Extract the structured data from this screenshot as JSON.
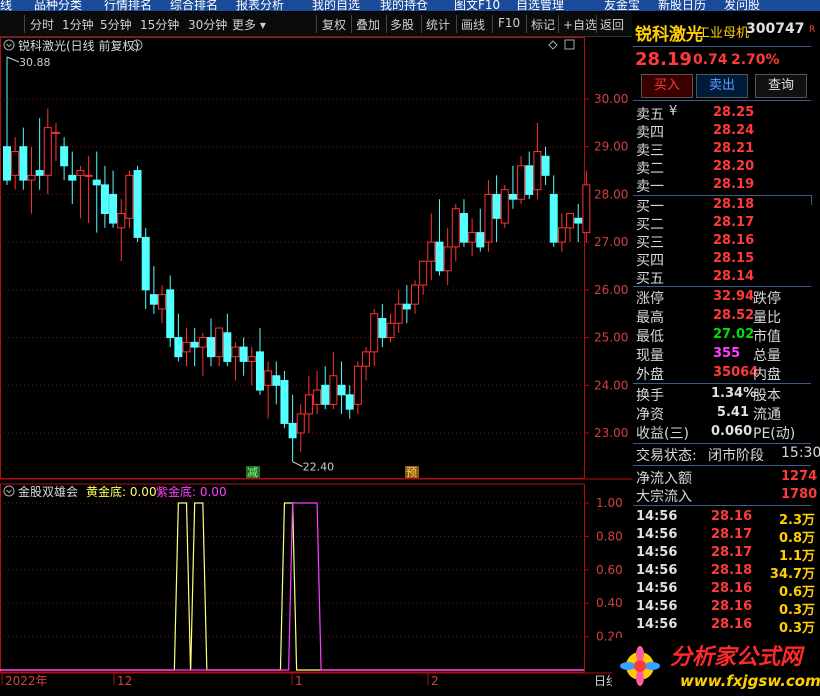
{
  "top_menu": [
    "线",
    "品种分类",
    "行情排名",
    "综合排名",
    "报表分析",
    "我的自选",
    "我的持仓",
    "图文F10",
    "自选管理",
    "友金宝",
    "新股日历",
    "发问股"
  ],
  "toolbar": {
    "periods": [
      "分时",
      "1分钟",
      "5分钟",
      "15分钟",
      "30分钟",
      "更多"
    ],
    "actions": [
      "复权",
      "叠加",
      "多股",
      "统计",
      "画线",
      "F10",
      "标记",
      "+自选",
      "返回"
    ]
  },
  "chart": {
    "title": "锐科激光(日线 前复权)",
    "high_marker": "30.88",
    "low_marker": "22.40",
    "signal_1": "减",
    "signal_2": "预",
    "price_axis": [
      "30.00",
      "29.00",
      "28.00",
      "27.00",
      "26.00",
      "25.00",
      "24.00",
      "23.00"
    ],
    "indicator_title": "金股双雄会",
    "ind_gold_label": "黄金底: 0.00",
    "ind_purple_label": "紫金底: 0.00",
    "ind_axis": [
      "1.00",
      "0.80",
      "0.60",
      "0.40",
      "0.20"
    ],
    "date_labels": [
      "2022年",
      "12",
      "1",
      "2"
    ],
    "date_right": "日线"
  },
  "chart_data": {
    "type": "candlestick",
    "candles": [
      {
        "o": 29.0,
        "h": 30.88,
        "l": 28.2,
        "c": 28.3
      },
      {
        "o": 28.4,
        "h": 29.2,
        "l": 28.1,
        "c": 28.9
      },
      {
        "o": 29.0,
        "h": 29.4,
        "l": 28.1,
        "c": 28.3
      },
      {
        "o": 28.3,
        "h": 29.0,
        "l": 27.6,
        "c": 28.4
      },
      {
        "o": 28.5,
        "h": 29.6,
        "l": 28.1,
        "c": 28.4
      },
      {
        "o": 28.4,
        "h": 29.8,
        "l": 28.0,
        "c": 29.4
      },
      {
        "o": 29.3,
        "h": 29.5,
        "l": 28.7,
        "c": 29.3
      },
      {
        "o": 29.0,
        "h": 29.2,
        "l": 28.3,
        "c": 28.6
      },
      {
        "o": 28.4,
        "h": 28.9,
        "l": 27.8,
        "c": 28.3
      },
      {
        "o": 28.4,
        "h": 28.6,
        "l": 27.5,
        "c": 28.5
      },
      {
        "o": 28.4,
        "h": 28.8,
        "l": 27.4,
        "c": 28.4
      },
      {
        "o": 28.3,
        "h": 28.9,
        "l": 27.2,
        "c": 28.2
      },
      {
        "o": 28.2,
        "h": 28.6,
        "l": 27.3,
        "c": 27.6
      },
      {
        "o": 28.0,
        "h": 28.5,
        "l": 27.3,
        "c": 27.4
      },
      {
        "o": 27.3,
        "h": 27.9,
        "l": 26.6,
        "c": 27.6
      },
      {
        "o": 27.5,
        "h": 28.5,
        "l": 27.3,
        "c": 28.4
      },
      {
        "o": 28.5,
        "h": 28.6,
        "l": 27.0,
        "c": 27.1
      },
      {
        "o": 27.1,
        "h": 27.3,
        "l": 25.6,
        "c": 26.0
      },
      {
        "o": 25.9,
        "h": 26.5,
        "l": 25.5,
        "c": 25.7
      },
      {
        "o": 25.6,
        "h": 26.1,
        "l": 25.3,
        "c": 25.9
      },
      {
        "o": 26.0,
        "h": 26.3,
        "l": 24.8,
        "c": 25.0
      },
      {
        "o": 25.0,
        "h": 25.5,
        "l": 24.5,
        "c": 24.6
      },
      {
        "o": 24.7,
        "h": 25.2,
        "l": 24.4,
        "c": 24.9
      },
      {
        "o": 24.9,
        "h": 25.2,
        "l": 24.4,
        "c": 24.8
      },
      {
        "o": 24.8,
        "h": 25.1,
        "l": 24.2,
        "c": 25.0
      },
      {
        "o": 25.0,
        "h": 25.4,
        "l": 24.4,
        "c": 24.6
      },
      {
        "o": 24.6,
        "h": 25.1,
        "l": 24.4,
        "c": 25.2
      },
      {
        "o": 25.1,
        "h": 25.5,
        "l": 24.4,
        "c": 24.5
      },
      {
        "o": 24.6,
        "h": 24.9,
        "l": 24.1,
        "c": 24.8
      },
      {
        "o": 24.8,
        "h": 25.0,
        "l": 24.2,
        "c": 24.5
      },
      {
        "o": 24.5,
        "h": 24.8,
        "l": 24.0,
        "c": 24.6
      },
      {
        "o": 24.7,
        "h": 25.2,
        "l": 23.8,
        "c": 23.9
      },
      {
        "o": 24.0,
        "h": 24.5,
        "l": 23.3,
        "c": 24.3
      },
      {
        "o": 24.2,
        "h": 24.5,
        "l": 23.6,
        "c": 24.0
      },
      {
        "o": 24.1,
        "h": 24.3,
        "l": 23.1,
        "c": 23.2
      },
      {
        "o": 23.2,
        "h": 23.8,
        "l": 22.4,
        "c": 22.9
      },
      {
        "o": 23.0,
        "h": 23.6,
        "l": 22.6,
        "c": 23.4
      },
      {
        "o": 23.4,
        "h": 24.2,
        "l": 23.0,
        "c": 23.8
      },
      {
        "o": 23.6,
        "h": 24.3,
        "l": 23.4,
        "c": 23.9
      },
      {
        "o": 24.0,
        "h": 24.4,
        "l": 23.5,
        "c": 23.6
      },
      {
        "o": 23.6,
        "h": 24.7,
        "l": 23.5,
        "c": 24.2
      },
      {
        "o": 24.0,
        "h": 24.5,
        "l": 23.4,
        "c": 23.8
      },
      {
        "o": 23.8,
        "h": 24.0,
        "l": 23.3,
        "c": 23.5
      },
      {
        "o": 23.6,
        "h": 24.5,
        "l": 23.4,
        "c": 24.4
      },
      {
        "o": 24.4,
        "h": 24.8,
        "l": 24.1,
        "c": 24.7
      },
      {
        "o": 24.7,
        "h": 25.6,
        "l": 24.4,
        "c": 25.5
      },
      {
        "o": 25.4,
        "h": 25.7,
        "l": 24.8,
        "c": 25.0
      },
      {
        "o": 25.0,
        "h": 25.5,
        "l": 24.9,
        "c": 25.3
      },
      {
        "o": 25.3,
        "h": 26.0,
        "l": 25.1,
        "c": 25.7
      },
      {
        "o": 25.7,
        "h": 26.1,
        "l": 25.3,
        "c": 25.6
      },
      {
        "o": 25.7,
        "h": 26.2,
        "l": 25.5,
        "c": 26.1
      },
      {
        "o": 26.1,
        "h": 26.6,
        "l": 25.9,
        "c": 26.6
      },
      {
        "o": 26.6,
        "h": 27.6,
        "l": 26.2,
        "c": 27.0
      },
      {
        "o": 27.0,
        "h": 27.9,
        "l": 26.3,
        "c": 26.4
      },
      {
        "o": 26.4,
        "h": 27.3,
        "l": 26.1,
        "c": 26.9
      },
      {
        "o": 26.9,
        "h": 27.8,
        "l": 26.6,
        "c": 27.7
      },
      {
        "o": 27.6,
        "h": 27.9,
        "l": 26.9,
        "c": 27.0
      },
      {
        "o": 27.0,
        "h": 27.5,
        "l": 26.7,
        "c": 27.2
      },
      {
        "o": 27.2,
        "h": 27.7,
        "l": 26.8,
        "c": 26.9
      },
      {
        "o": 27.0,
        "h": 28.3,
        "l": 26.8,
        "c": 28.0
      },
      {
        "o": 28.0,
        "h": 28.4,
        "l": 27.0,
        "c": 27.5
      },
      {
        "o": 27.4,
        "h": 28.2,
        "l": 27.3,
        "c": 28.1
      },
      {
        "o": 28.0,
        "h": 28.6,
        "l": 27.7,
        "c": 27.9
      },
      {
        "o": 27.9,
        "h": 28.8,
        "l": 27.8,
        "c": 28.6
      },
      {
        "o": 28.6,
        "h": 28.9,
        "l": 27.9,
        "c": 28.0
      },
      {
        "o": 28.1,
        "h": 29.5,
        "l": 27.9,
        "c": 28.9
      },
      {
        "o": 28.8,
        "h": 29.0,
        "l": 28.2,
        "c": 28.4
      },
      {
        "o": 28.0,
        "h": 28.4,
        "l": 26.9,
        "c": 27.0
      },
      {
        "o": 27.0,
        "h": 27.6,
        "l": 26.8,
        "c": 27.3
      },
      {
        "o": 27.3,
        "h": 27.6,
        "l": 27.0,
        "c": 27.6
      },
      {
        "o": 27.5,
        "h": 27.8,
        "l": 27.0,
        "c": 27.4
      },
      {
        "o": 27.2,
        "h": 28.5,
        "l": 27.0,
        "c": 28.2
      }
    ],
    "y_range": [
      22.2,
      31.1
    ],
    "indicator": {
      "type": "line",
      "ylim": [
        0,
        1
      ],
      "series": [
        {
          "name": "黄金底",
          "color": "#ffff80",
          "pulses": [
            [
              21,
              22
            ],
            [
              23,
              24
            ],
            [
              34,
              35
            ]
          ]
        },
        {
          "name": "紫金底",
          "color": "#ff40ff",
          "pulses": [
            [
              35,
              38
            ]
          ]
        }
      ]
    }
  },
  "quote": {
    "name": "锐科激光",
    "tag": "工业母机",
    "code": "300747",
    "r": "R",
    "price": "28.19",
    "change": "0.74",
    "pct": "2.70%",
    "buttons": [
      "买入",
      "卖出",
      "查询"
    ],
    "sells": [
      [
        "卖五",
        "¥",
        "28.25"
      ],
      [
        "卖四",
        "",
        "28.24"
      ],
      [
        "卖三",
        "",
        "28.21"
      ],
      [
        "卖二",
        "",
        "28.20"
      ],
      [
        "卖一",
        "",
        "28.19"
      ]
    ],
    "buys": [
      [
        "买一",
        "28.18"
      ],
      [
        "买二",
        "28.17"
      ],
      [
        "买三",
        "28.16"
      ],
      [
        "买四",
        "28.15"
      ],
      [
        "买五",
        "28.14"
      ]
    ],
    "stats": [
      {
        "l": "涨停",
        "v": "32.94",
        "c": "red",
        "l2": "跌停"
      },
      {
        "l": "最高",
        "v": "28.52",
        "c": "red",
        "l2": "量比"
      },
      {
        "l": "最低",
        "v": "27.02",
        "c": "green",
        "l2": "市值"
      },
      {
        "l": "现量",
        "v": "355",
        "c": "purple",
        "l2": "总量"
      },
      {
        "l": "外盘",
        "v": "35064",
        "c": "red",
        "l2": "内盘"
      }
    ],
    "stats2": [
      {
        "l": "换手",
        "v": "1.34%",
        "l2": "股本"
      },
      {
        "l": "净资",
        "v": "5.41",
        "l2": "流通"
      },
      {
        "l": "收益(三)",
        "v": "0.060",
        "l2": "PE(动)"
      }
    ],
    "status_label": "交易状态:",
    "status_value": "闭市阶段",
    "status_time": "15:30",
    "flow": [
      {
        "l": "净流入额",
        "v": "1274"
      },
      {
        "l": "大宗流入",
        "v": "1780"
      }
    ],
    "ticks": [
      [
        "14:56",
        "28.16",
        "2.3万"
      ],
      [
        "14:56",
        "28.17",
        "0.8万"
      ],
      [
        "14:56",
        "28.17",
        "1.1万"
      ],
      [
        "14:56",
        "28.18",
        "34.7万"
      ],
      [
        "14:56",
        "28.16",
        "0.6万"
      ],
      [
        "14:56",
        "28.16",
        "0.3万"
      ],
      [
        "14:56",
        "28.16",
        "0.3万"
      ]
    ]
  },
  "watermark": {
    "text": "分析家公式网",
    "url": "www.fxjgsw.com"
  }
}
